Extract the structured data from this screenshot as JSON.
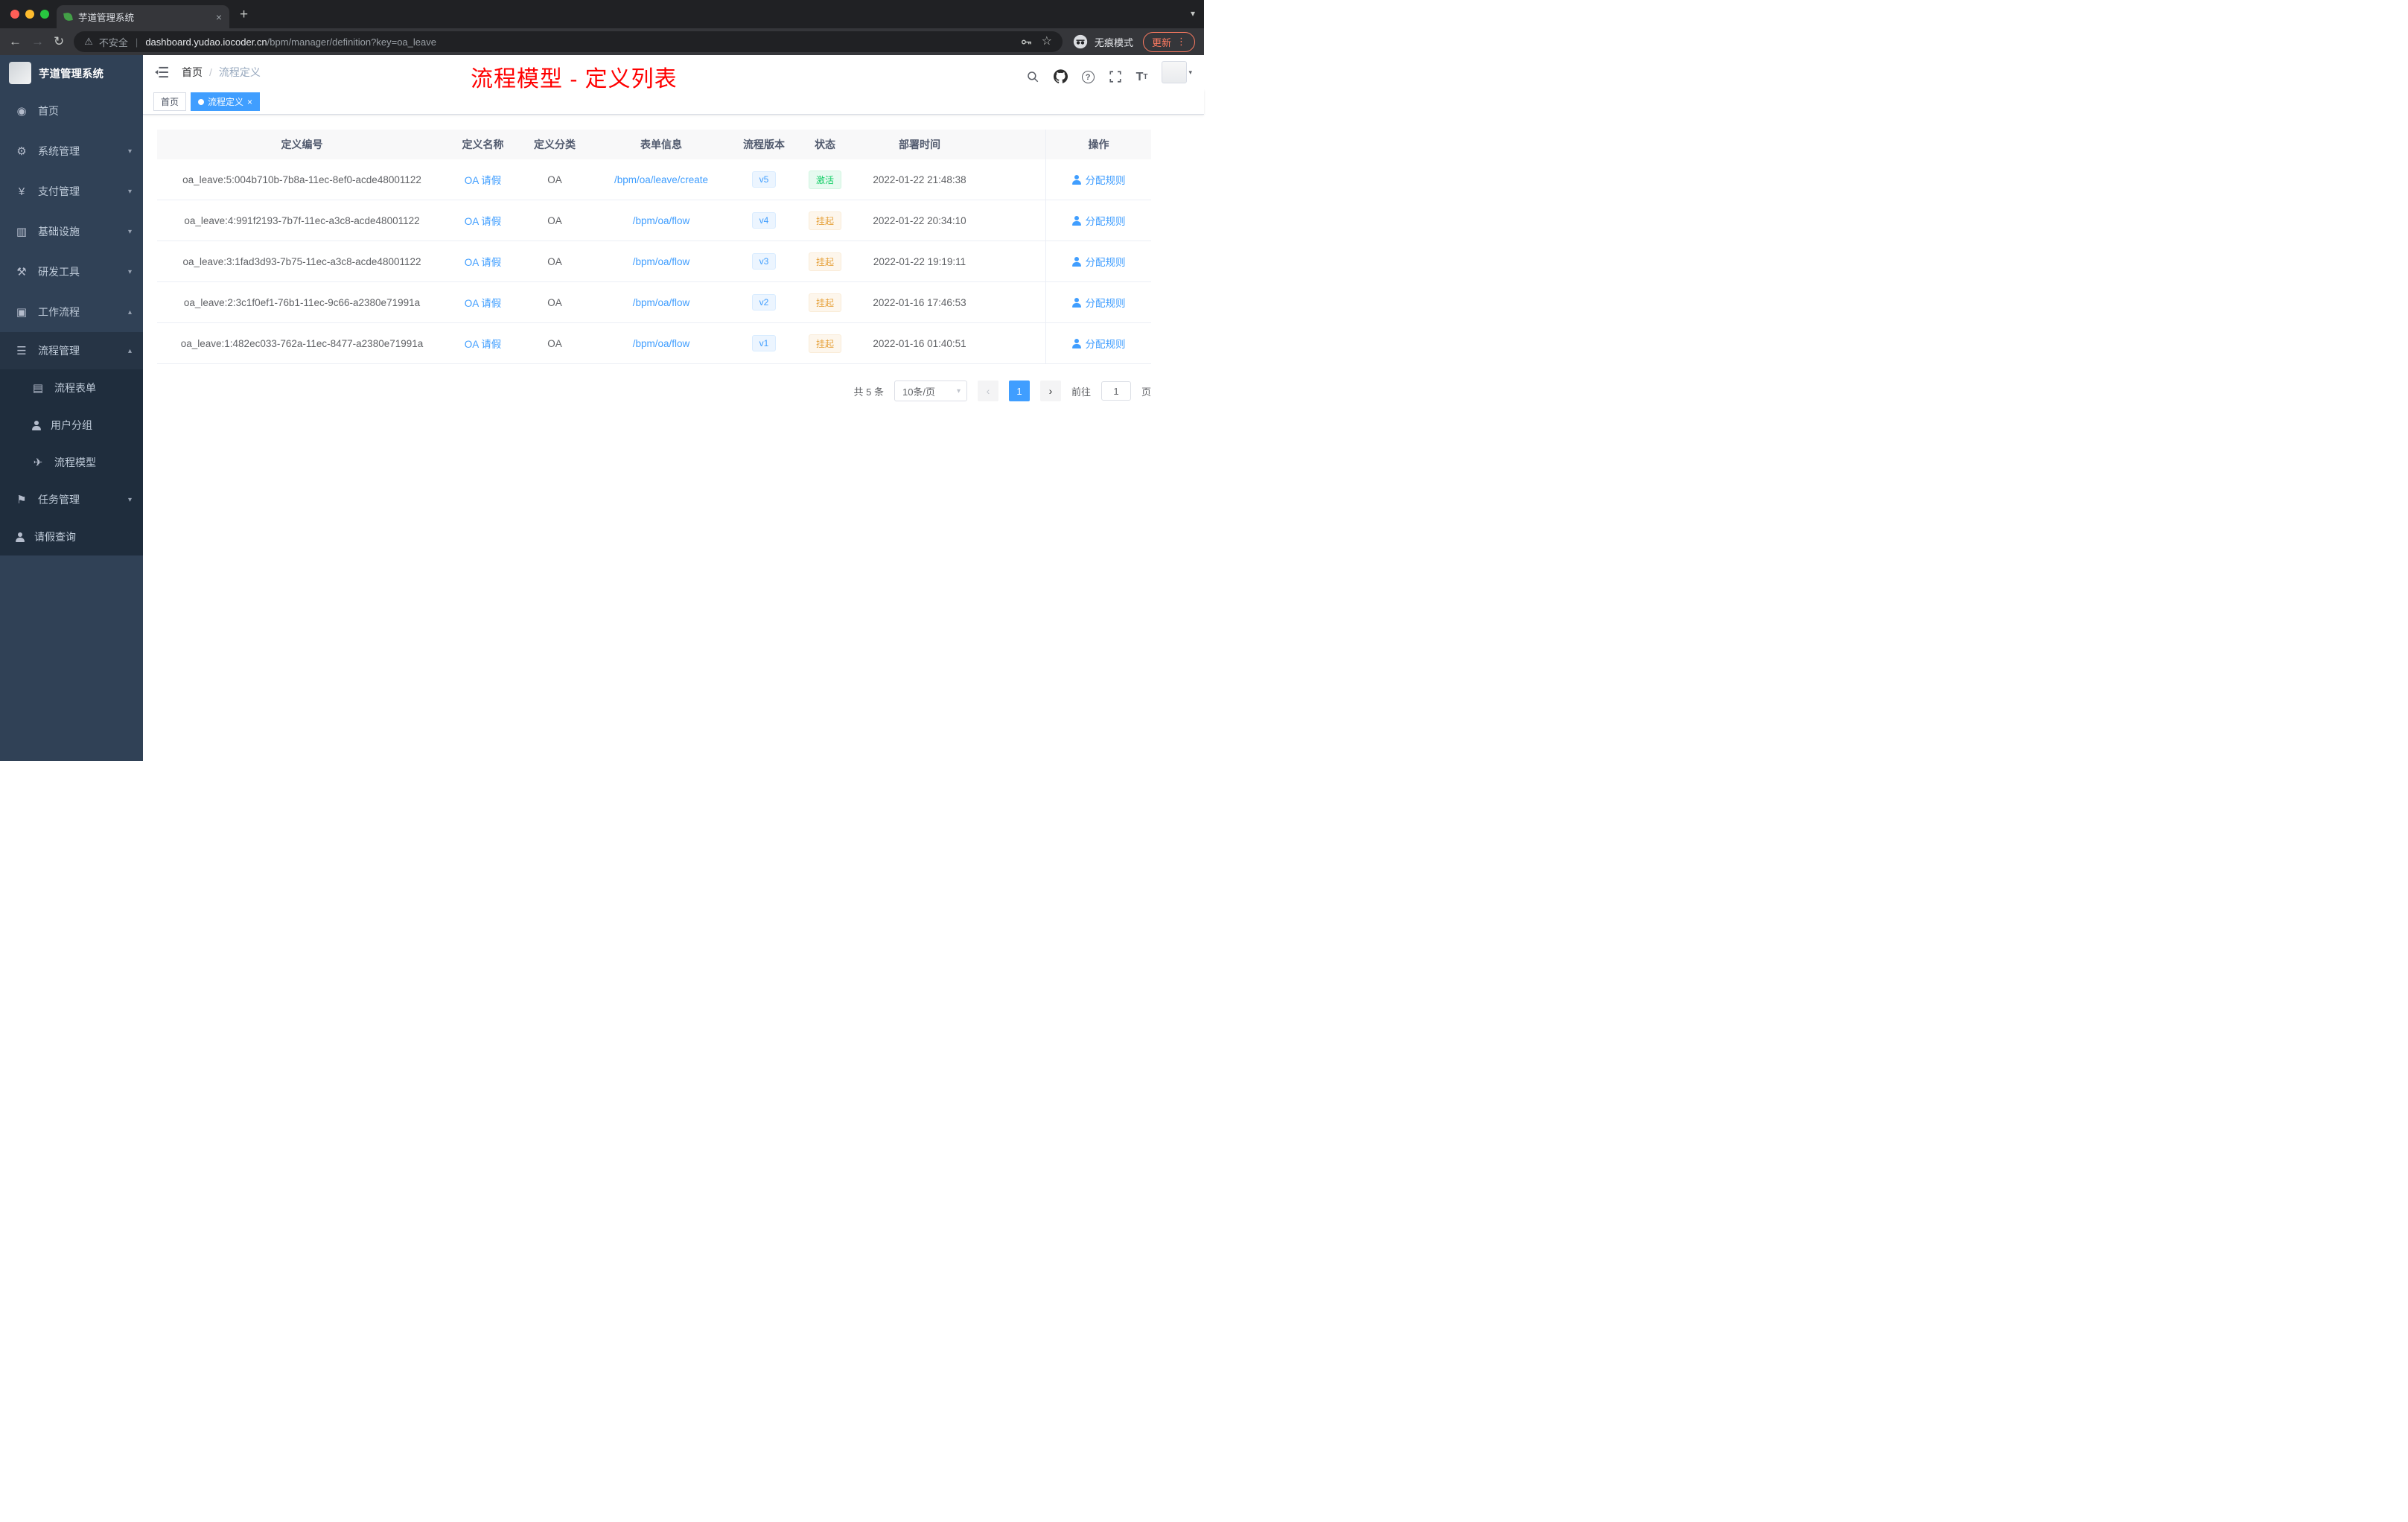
{
  "browser": {
    "tab_title": "芋道管理系统",
    "security_label": "不安全",
    "url_host": "dashboard.yudao.iocoder.cn",
    "url_path": "/bpm/manager/definition?key=oa_leave",
    "incognito_label": "无痕模式",
    "update_label": "更新"
  },
  "icons": {
    "dashboard": "◉",
    "gear": "⚙",
    "yen": "¥",
    "monitor": "▥",
    "tools": "⚒",
    "workflow": "▣",
    "list": "☰",
    "form": "▤",
    "plane": "✈",
    "flag": "⚑",
    "chevron_down": "▾",
    "chevron_up": "▴",
    "close": "×",
    "plus": "+",
    "back": "←",
    "forward": "→",
    "reload": "↻",
    "warning": "⚠",
    "star": "☆",
    "dots": "⋮",
    "prev": "‹",
    "next": "›",
    "caret": "▾",
    "question": "?"
  },
  "sidebar": {
    "logo_title": "芋道管理系统",
    "items": [
      {
        "label": "首页"
      },
      {
        "label": "系统管理"
      },
      {
        "label": "支付管理"
      },
      {
        "label": "基础设施"
      },
      {
        "label": "研发工具"
      },
      {
        "label": "工作流程"
      },
      {
        "label": "流程管理"
      },
      {
        "label": "流程表单"
      },
      {
        "label": "用户分组"
      },
      {
        "label": "流程模型"
      },
      {
        "label": "任务管理"
      },
      {
        "label": "请假查询"
      }
    ]
  },
  "header": {
    "breadcrumb_home": "首页",
    "breadcrumb_current": "流程定义",
    "annotation": "流程模型 - 定义列表"
  },
  "tags": {
    "home": "首页",
    "active": "流程定义"
  },
  "table": {
    "columns": [
      "定义编号",
      "定义名称",
      "定义分类",
      "表单信息",
      "流程版本",
      "状态",
      "部署时间",
      "操作"
    ],
    "rows": [
      {
        "id": "oa_leave:5:004b710b-7b8a-11ec-8ef0-acde48001122",
        "name": "OA 请假",
        "category": "OA",
        "form": "/bpm/oa/leave/create",
        "version": "v5",
        "status": "激活",
        "status_type": "success",
        "time": "2022-01-22 21:48:38",
        "action": "分配规则"
      },
      {
        "id": "oa_leave:4:991f2193-7b7f-11ec-a3c8-acde48001122",
        "name": "OA 请假",
        "category": "OA",
        "form": "/bpm/oa/flow",
        "version": "v4",
        "status": "挂起",
        "status_type": "warning",
        "time": "2022-01-22 20:34:10",
        "action": "分配规则"
      },
      {
        "id": "oa_leave:3:1fad3d93-7b75-11ec-a3c8-acde48001122",
        "name": "OA 请假",
        "category": "OA",
        "form": "/bpm/oa/flow",
        "version": "v3",
        "status": "挂起",
        "status_type": "warning",
        "time": "2022-01-22 19:19:11",
        "action": "分配规则"
      },
      {
        "id": "oa_leave:2:3c1f0ef1-76b1-11ec-9c66-a2380e71991a",
        "name": "OA 请假",
        "category": "OA",
        "form": "/bpm/oa/flow",
        "version": "v2",
        "status": "挂起",
        "status_type": "warning",
        "time": "2022-01-16 17:46:53",
        "action": "分配规则"
      },
      {
        "id": "oa_leave:1:482ec033-762a-11ec-8477-a2380e71991a",
        "name": "OA 请假",
        "category": "OA",
        "form": "/bpm/oa/flow",
        "version": "v1",
        "status": "挂起",
        "status_type": "warning",
        "time": "2022-01-16 01:40:51",
        "action": "分配规则"
      }
    ]
  },
  "pagination": {
    "total": "共 5 条",
    "page_size": "10条/页",
    "page": "1",
    "goto_label": "前往",
    "goto_value": "1",
    "unit": "页"
  }
}
